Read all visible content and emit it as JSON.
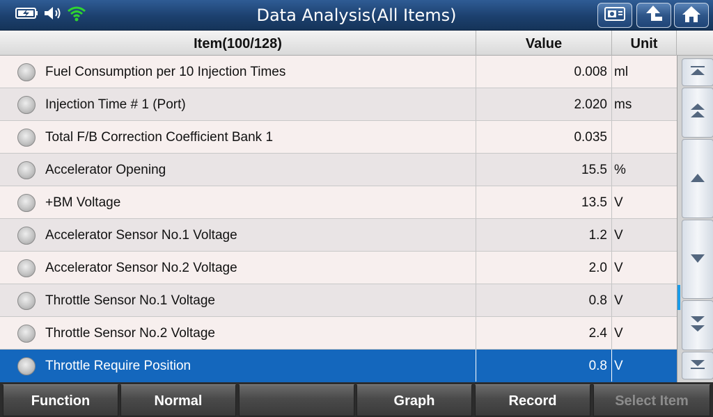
{
  "title": "Data Analysis(All Items)",
  "status_icons": [
    "battery-icon",
    "speaker-icon",
    "wifi-icon"
  ],
  "title_buttons": [
    "screenshot-icon",
    "back-icon",
    "home-icon"
  ],
  "table": {
    "headers": {
      "item": "Item(100/128)",
      "value": "Value",
      "unit": "Unit"
    },
    "rows": [
      {
        "name": "Fuel Consumption per 10 Injection Times",
        "value": "0.008",
        "unit": "ml"
      },
      {
        "name": "Injection Time # 1 (Port)",
        "value": "2.020",
        "unit": "ms"
      },
      {
        "name": "Total F/B Correction Coefficient Bank 1",
        "value": "0.035",
        "unit": ""
      },
      {
        "name": "Accelerator Opening",
        "value": "15.5",
        "unit": "%"
      },
      {
        "name": "+BM Voltage",
        "value": "13.5",
        "unit": "V"
      },
      {
        "name": "Accelerator Sensor No.1 Voltage",
        "value": "1.2",
        "unit": "V"
      },
      {
        "name": "Accelerator Sensor No.2 Voltage",
        "value": "2.0",
        "unit": "V"
      },
      {
        "name": "Throttle Sensor No.1 Voltage",
        "value": "0.8",
        "unit": "V"
      },
      {
        "name": "Throttle Sensor No.2 Voltage",
        "value": "2.4",
        "unit": "V"
      },
      {
        "name": "Throttle Require Position",
        "value": "0.8",
        "unit": "V"
      }
    ],
    "selected_row": 9
  },
  "scroll_buttons": [
    "scroll-top-icon",
    "page-up-icon",
    "line-up-icon",
    "line-down-icon",
    "page-down-icon",
    "scroll-bottom-icon"
  ],
  "toolbar": {
    "function": "Function",
    "normal": "Normal",
    "blank": "",
    "graph": "Graph",
    "record": "Record",
    "select_item": "Select Item"
  },
  "colors": {
    "title_bar": "#1c406e",
    "selected_row": "#1467bd",
    "wifi": "#2fd62f",
    "scroll_thumb": "#1a9be8"
  }
}
